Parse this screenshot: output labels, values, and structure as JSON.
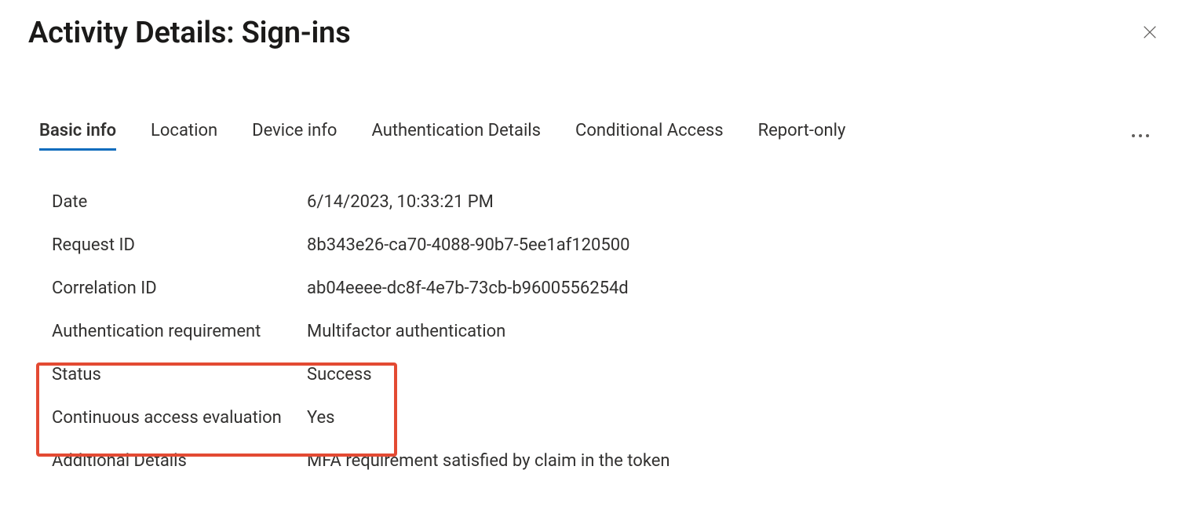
{
  "header": {
    "title": "Activity Details: Sign-ins"
  },
  "tabs": [
    {
      "label": "Basic info",
      "active": true
    },
    {
      "label": "Location",
      "active": false
    },
    {
      "label": "Device info",
      "active": false
    },
    {
      "label": "Authentication Details",
      "active": false
    },
    {
      "label": "Conditional Access",
      "active": false
    },
    {
      "label": "Report-only",
      "active": false
    }
  ],
  "details": {
    "date": {
      "label": "Date",
      "value": "6/14/2023, 10:33:21 PM"
    },
    "request_id": {
      "label": "Request ID",
      "value": "8b343e26-ca70-4088-90b7-5ee1af120500"
    },
    "correlation_id": {
      "label": "Correlation ID",
      "value": "ab04eeee-dc8f-4e7b-73cb-b9600556254d"
    },
    "auth_requirement": {
      "label": "Authentication requirement",
      "value": "Multifactor authentication"
    },
    "status": {
      "label": "Status",
      "value": "Success"
    },
    "cae": {
      "label": "Continuous access evaluation",
      "value": "Yes"
    },
    "additional": {
      "label": "Additional Details",
      "value": "MFA requirement satisfied by claim in the token"
    }
  }
}
